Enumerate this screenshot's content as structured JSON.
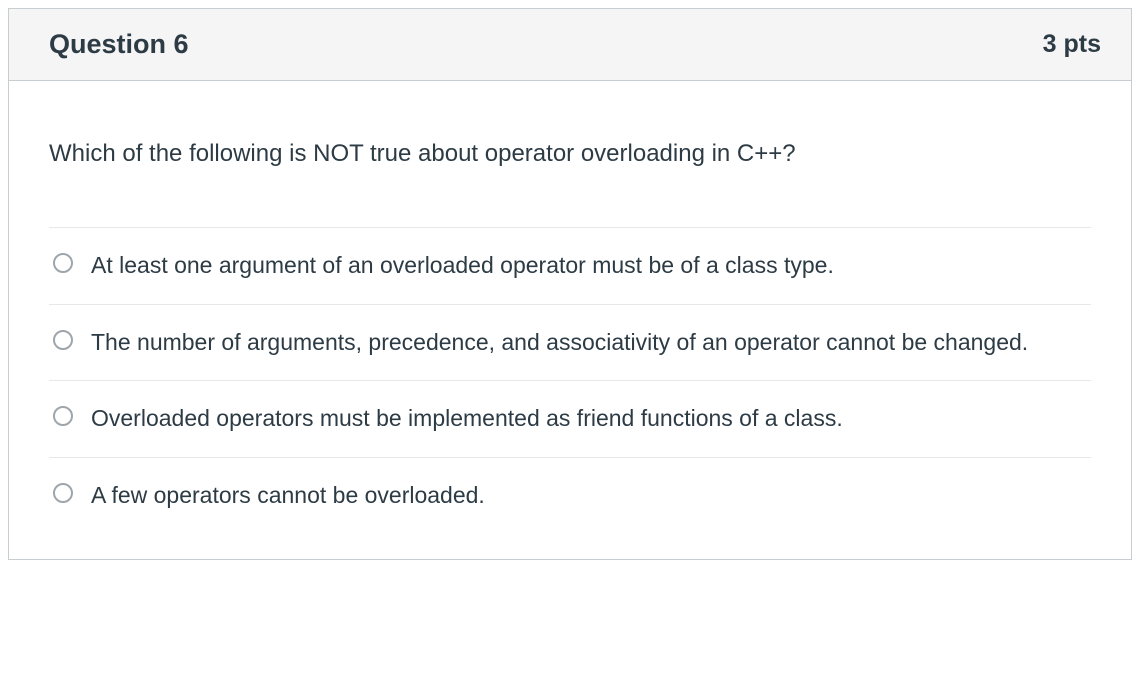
{
  "header": {
    "title": "Question 6",
    "points": "3 pts"
  },
  "prompt": "Which of the following is NOT true about operator overloading in C++?",
  "options": [
    {
      "label": "At least one argument of an overloaded operator must be of a class type."
    },
    {
      "label": "The number of arguments, precedence, and associativity of an operator cannot be changed."
    },
    {
      "label": "Overloaded operators must be implemented as friend functions of a class."
    },
    {
      "label": "A few operators cannot be overloaded."
    }
  ]
}
